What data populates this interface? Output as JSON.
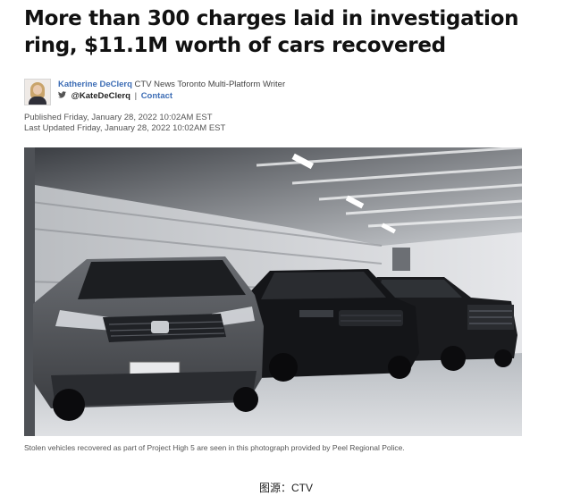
{
  "article": {
    "headline_line1": "More than 300 charges laid in investigation",
    "headline_line2": "ring, $11.1M worth of cars recovered",
    "author": {
      "name": "Katherine DeClerq",
      "role": "CTV News Toronto Multi-Platform Writer",
      "handle": "@KateDeClerq",
      "separator": "|",
      "contact_label": "Contact"
    },
    "published": "Published Friday, January 28, 2022 10:02AM EST",
    "updated": "Last Updated Friday, January 28, 2022 10:02AM EST",
    "photo": {
      "plate_text": "",
      "caption": "Stolen vehicles recovered as part of Project High 5 are seen in this photograph provided by Peel Regional Police."
    }
  },
  "image_source": "图源：CTV",
  "icons": {
    "twitter": "twitter-icon"
  },
  "colors": {
    "link": "#3d6db5",
    "headline": "#111111",
    "meta": "#555555"
  }
}
